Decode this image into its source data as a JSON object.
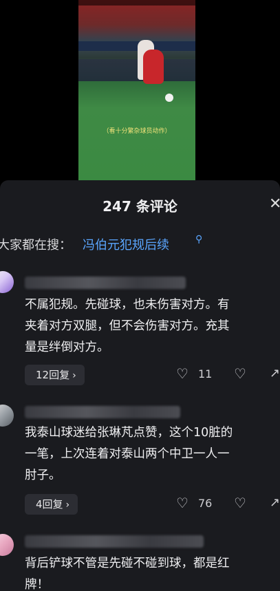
{
  "video": {
    "subtitle": "（看十分繁杂球员动作）"
  },
  "panel": {
    "title": "247 条评论",
    "close_icon": "close-icon",
    "search_label": "大家都在搜：",
    "search_term": "冯伯元犯规后续",
    "search_icon": "search-icon"
  },
  "comments": [
    {
      "text": "不属犯规。先碰球，也未伤害对方。有\n夹着对方双腿，但不会伤害对方。充其\n量是绊倒对方。",
      "replies": "12回复",
      "likes": "11"
    },
    {
      "text": "我泰山球迷给张琳芃点赞，这个10脏的\n一笔，上次连着对泰山两个中卫一人一\n肘子。",
      "replies": "4回复",
      "likes": "76"
    },
    {
      "text": "背后铲球不管是先碰不碰到球，都是红\n牌！"
    }
  ],
  "colors": {
    "accent": "#5aa6ff",
    "panel_bg": "#1a1b1f",
    "reply_bg": "#2c2d33"
  }
}
